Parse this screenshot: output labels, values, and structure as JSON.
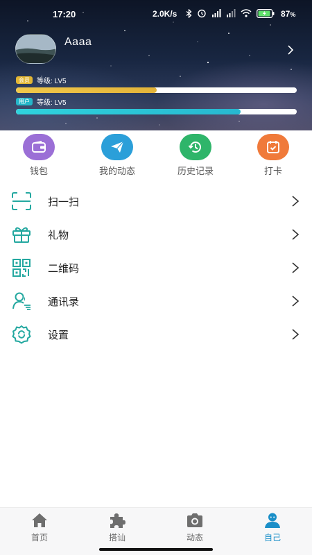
{
  "status_bar": {
    "time": "17:20",
    "speed": "2.0K/s",
    "battery": "87",
    "icons": [
      "bluetooth-icon",
      "alarm-icon",
      "signal-icon",
      "signal-icon",
      "wifi-icon",
      "battery-icon"
    ]
  },
  "profile": {
    "username": "Aaaa",
    "member_badge": "会员",
    "member_level": "等级: LV5",
    "member_progress": 0.5,
    "user_badge": "用户",
    "user_level": "等级: LV5",
    "user_progress": 0.8
  },
  "quick_actions": [
    {
      "label": "钱包",
      "icon": "wallet-icon",
      "color": "#9b6fd6"
    },
    {
      "label": "我的动态",
      "icon": "paper-plane-icon",
      "color": "#2b9fd9"
    },
    {
      "label": "历史记录",
      "icon": "history-icon",
      "color": "#2fb56a"
    },
    {
      "label": "打卡",
      "icon": "calendar-check-icon",
      "color": "#f07a3a"
    }
  ],
  "menu": [
    {
      "label": "扫一扫",
      "icon": "scan-icon"
    },
    {
      "label": "礼物",
      "icon": "gift-icon"
    },
    {
      "label": "二维码",
      "icon": "qrcode-icon"
    },
    {
      "label": "通讯录",
      "icon": "contacts-icon"
    },
    {
      "label": "设置",
      "icon": "settings-icon"
    }
  ],
  "bottom_nav": [
    {
      "label": "首页",
      "icon": "home-icon",
      "active": false
    },
    {
      "label": "搭讪",
      "icon": "puzzle-icon",
      "active": false
    },
    {
      "label": "动态",
      "icon": "camera-icon",
      "active": false
    },
    {
      "label": "自己",
      "icon": "user-icon",
      "active": true
    }
  ],
  "colors": {
    "accent": "#1b8fc8",
    "menu_icon": "#24a8a0",
    "member_bar": "#e3b43a",
    "user_bar": "#27b8d0"
  }
}
